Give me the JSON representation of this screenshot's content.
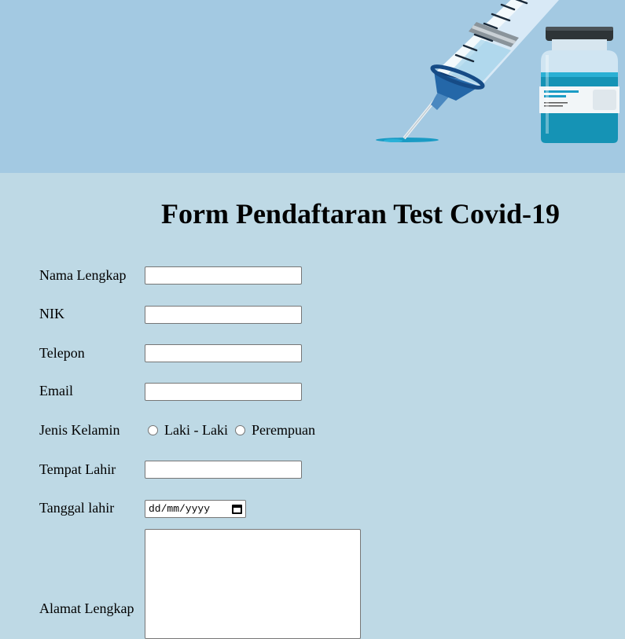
{
  "page": {
    "title": "Form Pendaftaran Test Covid-19"
  },
  "form": {
    "nama": {
      "label": "Nama Lengkap",
      "value": ""
    },
    "nik": {
      "label": "NIK",
      "value": ""
    },
    "telepon": {
      "label": "Telepon",
      "value": ""
    },
    "email": {
      "label": "Email",
      "value": ""
    },
    "jenis_kelamin": {
      "label": "Jenis Kelamin",
      "options": [
        "Laki - Laki",
        "Perempuan"
      ],
      "selected": null
    },
    "tempat_lahir": {
      "label": "Tempat Lahir",
      "value": ""
    },
    "tanggal_lahir": {
      "label": "Tanggal lahir",
      "placeholder": "dd/mm/yyyy",
      "icon": "calendar-icon"
    },
    "alamat": {
      "label": "Alamat Lengkap",
      "value": ""
    }
  },
  "colors": {
    "banner_bg": "#a3c9e2",
    "page_bg": "#bed9e5",
    "vial_liquid": "#1593b5",
    "vial_cap": "#2e3437",
    "syringe_plunger": "#2169a8"
  }
}
